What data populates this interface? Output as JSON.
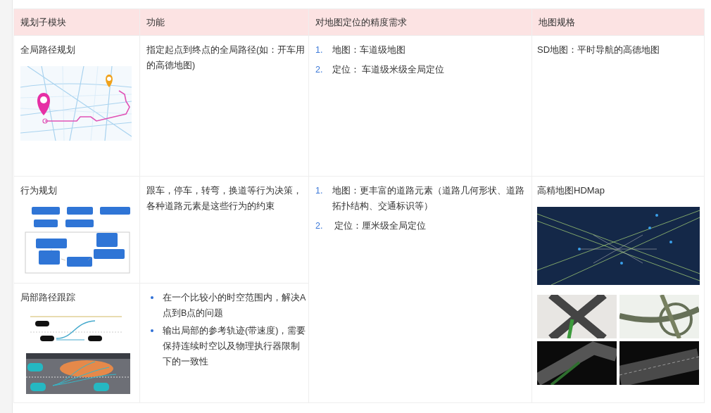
{
  "table": {
    "columns": [
      "规划子模块",
      "功能",
      "对地图定位的精度需求",
      "地图规格"
    ],
    "rows": [
      {
        "module": "全局路径规划",
        "figure": {
          "kind": "route-map"
        },
        "function": {
          "kind": "text",
          "text": "指定起点到终点的全局路径(如：开车用的高德地图)"
        },
        "accuracy": [
          {
            "number": "1.",
            "text": "地图：车道级地图"
          },
          {
            "number": "2.",
            "text": "定位： 车道级米级全局定位"
          }
        ],
        "spec": {
          "text": "SD地图：平时导航的高德地图"
        }
      },
      {
        "module": "行为规划",
        "figure": {
          "kind": "flowchart"
        },
        "function": {
          "kind": "text",
          "text": "跟车，停车，转弯，换道等行为决策，各种道路元素是这些行为的约束"
        },
        "accuracy": [
          {
            "number": "1.",
            "text": "地图：更丰富的道路元素（道路几何形状、道路拓扑结构、交通标识等）"
          },
          {
            "number": "2.",
            "text": " 定位：厘米级全局定位"
          }
        ],
        "spec": {
          "text": "高精地图HDMap",
          "figures": [
            {
              "kind": "hd-map-render"
            },
            {
              "kind": "hd-map-grid"
            }
          ]
        }
      },
      {
        "module": "局部路径跟踪",
        "figure": {
          "kind": "lane-change"
        },
        "function": {
          "kind": "bullets",
          "items": [
            "在一个比较小的时空范围内，解决A点到B点的问题",
            "输出局部的参考轨迹(带速度)，需要保持连续时空以及物理执行器限制下的一致性"
          ]
        }
      }
    ]
  }
}
